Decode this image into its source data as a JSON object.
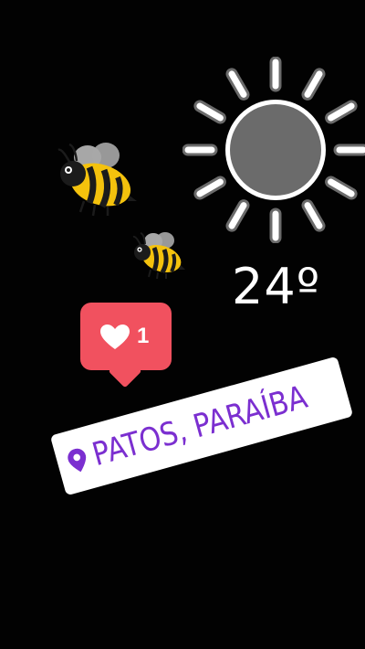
{
  "weather": {
    "icon": "sun-icon",
    "temperature": "24º"
  },
  "decorations": {
    "bee_large_icon": "bee-icon",
    "bee_small_icon": "bee-icon"
  },
  "like_notification": {
    "icon": "heart-icon",
    "count": "1",
    "color": "#f1515f"
  },
  "location": {
    "icon": "location-pin-icon",
    "name": "PATOS, PARAÍBA",
    "text_color": "#7b2fd0",
    "background": "#ffffff"
  }
}
